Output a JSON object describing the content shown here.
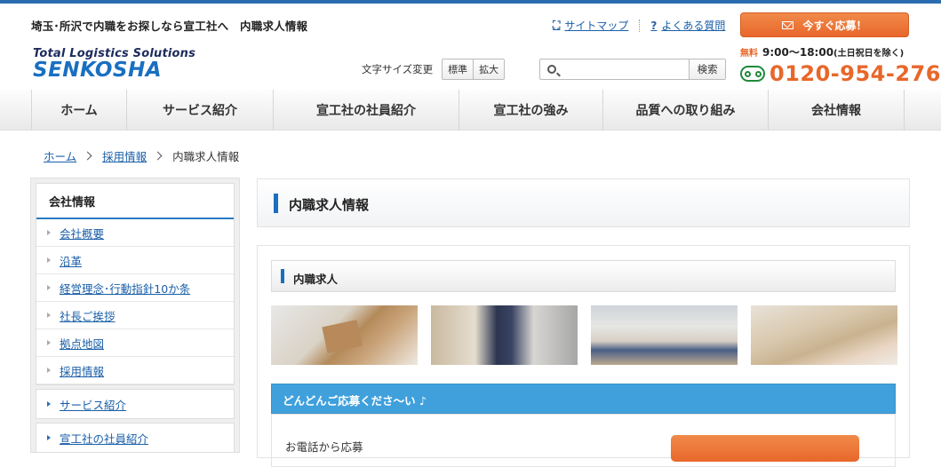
{
  "header": {
    "tagline": "埼玉･所沢で内職をお探しなら宣工社へ　内職求人情報",
    "links": [
      {
        "icon": "sitemap-icon",
        "glyph": "⛶",
        "label": "サイトマップ"
      },
      {
        "icon": "question-icon",
        "glyph": "?",
        "label": "よくある質問"
      }
    ],
    "apply_button": "今すぐ応募！",
    "logo": {
      "line1": "Total Logistics Solutions",
      "line2": "SENKOSHA"
    },
    "font_size": {
      "label": "文字サイズ変更",
      "standard": "標準",
      "large": "拡大"
    },
    "search": {
      "placeholder": "",
      "button": "検索"
    },
    "contact": {
      "free": "無料",
      "hours": "9:00〜18:00",
      "hours_note": "(土日祝日を除く)",
      "phone": "0120-954-276"
    }
  },
  "nav": {
    "items": [
      {
        "label": "ホーム"
      },
      {
        "label": "サービス紹介"
      },
      {
        "label": "宣工社の社員紹介"
      },
      {
        "label": "宣工社の強み"
      },
      {
        "label": "品質への取り組み"
      },
      {
        "label": "会社情報"
      }
    ]
  },
  "breadcrumb": {
    "home": "ホーム",
    "recruit": "採用情報",
    "current": "内職求人情報"
  },
  "sidebar": {
    "heading": "会社情報",
    "items": [
      {
        "label": "会社概要"
      },
      {
        "label": "沿革"
      },
      {
        "label": "経営理念･行動指針10か条"
      },
      {
        "label": "社長ご挨拶"
      },
      {
        "label": "拠点地図"
      },
      {
        "label": "採用情報"
      }
    ],
    "categories": [
      {
        "label": "サービス紹介"
      },
      {
        "label": "宣工社の社員紹介"
      }
    ]
  },
  "main": {
    "title": "内職求人情報",
    "section_title": "内職求人",
    "apply_heading": "どんどんご応募くださ〜い ♪",
    "apply_phone_label": "お電話から応募"
  },
  "colors": {
    "accent_blue": "#1a6fc0",
    "orange": "#e8672a",
    "apply_bar": "#3fa0dc"
  }
}
